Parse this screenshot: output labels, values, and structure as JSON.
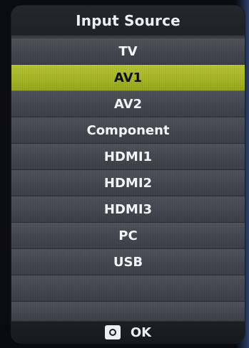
{
  "menu": {
    "title": "Input Source",
    "items": [
      {
        "label": "TV",
        "selected": false
      },
      {
        "label": "AV1",
        "selected": true
      },
      {
        "label": "AV2",
        "selected": false
      },
      {
        "label": "Component",
        "selected": false
      },
      {
        "label": "HDMI1",
        "selected": false
      },
      {
        "label": "HDMI2",
        "selected": false
      },
      {
        "label": "HDMI3",
        "selected": false
      },
      {
        "label": "PC",
        "selected": false
      },
      {
        "label": "USB",
        "selected": false
      }
    ],
    "selected_color": "#a6b526"
  },
  "footer": {
    "ok_icon": "remote-ok-icon",
    "ok_label": "OK"
  }
}
